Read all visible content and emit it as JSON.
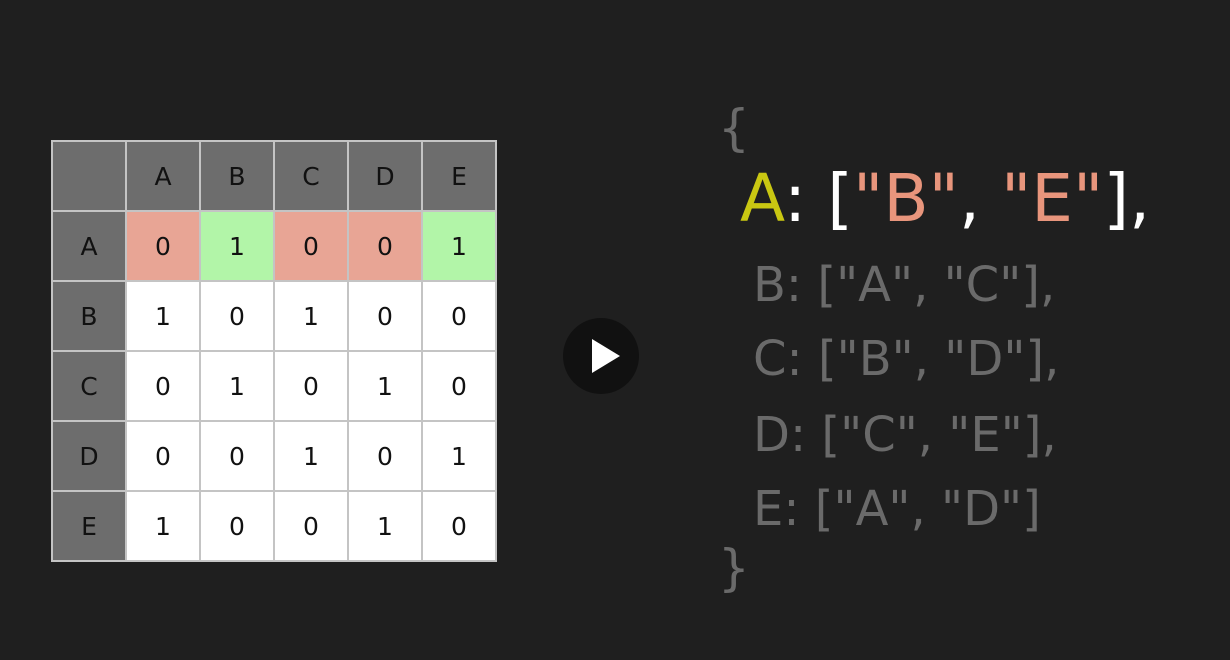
{
  "matrix": {
    "columns": [
      "A",
      "B",
      "C",
      "D",
      "E"
    ],
    "rows": [
      {
        "label": "A",
        "values": [
          "0",
          "1",
          "0",
          "0",
          "1"
        ],
        "highlight": [
          "zero",
          "one",
          "zero",
          "zero",
          "one"
        ]
      },
      {
        "label": "B",
        "values": [
          "1",
          "0",
          "1",
          "0",
          "0"
        ]
      },
      {
        "label": "C",
        "values": [
          "0",
          "1",
          "0",
          "1",
          "0"
        ]
      },
      {
        "label": "D",
        "values": [
          "0",
          "0",
          "1",
          "0",
          "1"
        ]
      },
      {
        "label": "E",
        "values": [
          "1",
          "0",
          "0",
          "1",
          "0"
        ]
      }
    ],
    "colors": {
      "header_bg": "#6d6d6d",
      "zero_highlight": "#e8a595",
      "one_highlight": "#b2f5a8",
      "cell_bg": "#ffffff"
    }
  },
  "player": {
    "icon": "play-icon"
  },
  "adjacency_list": {
    "open_brace": "{",
    "close_brace": "}",
    "active": {
      "key": "A",
      "colon": ": [",
      "n1": "\"B\"",
      "sep": ", ",
      "n2": "\"E\"",
      "tail": "],"
    },
    "lines": [
      "B: [\"A\", \"C\"],",
      "C: [\"B\", \"D\"],",
      "D: [\"C\", \"E\"],",
      "E: [\"A\", \"D\"]"
    ],
    "colors": {
      "active_key": "#c9c712",
      "active_string": "#e8957c",
      "dim": "#6a6a6a"
    }
  }
}
